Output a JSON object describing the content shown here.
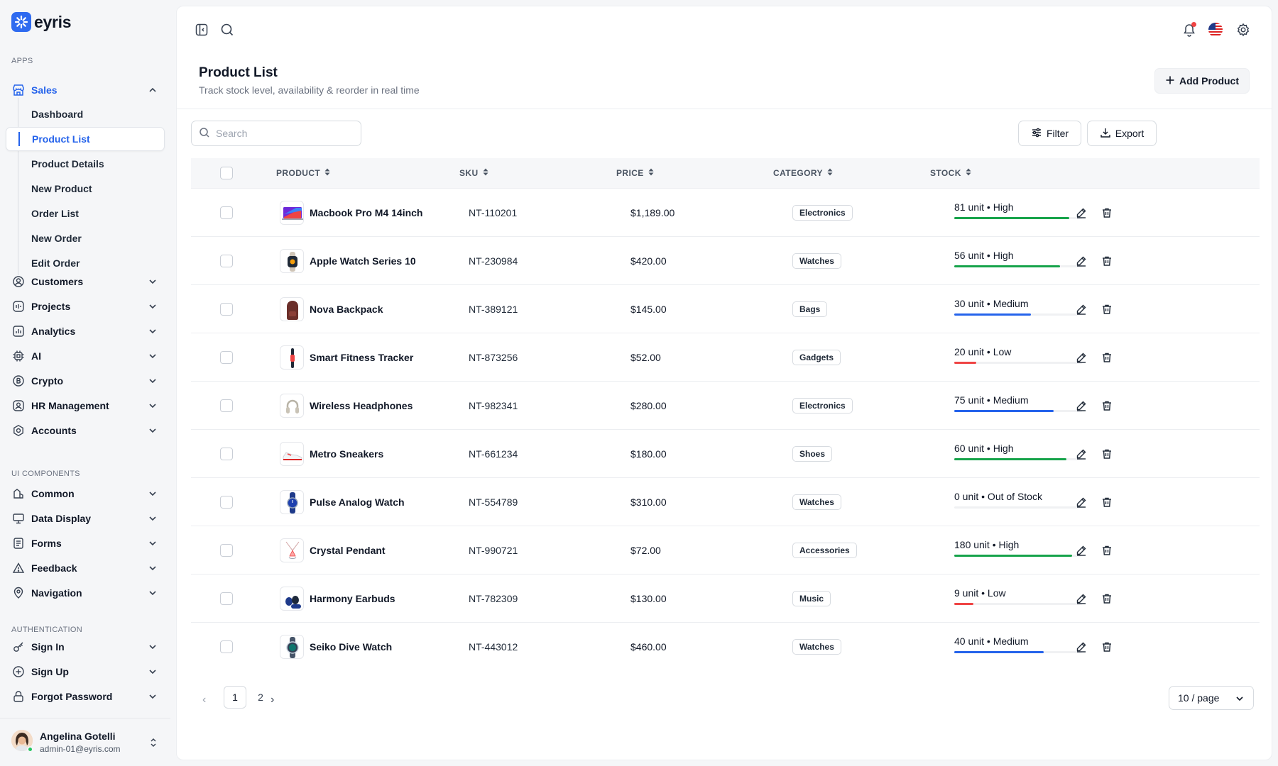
{
  "brand": {
    "name": "eyris",
    "color": "#2f6bf0"
  },
  "sidebar": {
    "sections": {
      "apps": "APPS",
      "ui": "UI COMPONENTS",
      "auth": "AUTHENTICATION"
    },
    "sales": {
      "label": "Sales",
      "icon": "store-icon"
    },
    "sales_sub": [
      "Dashboard",
      "Product List",
      "Product Details",
      "New Product",
      "Order List",
      "New Order",
      "Edit Order"
    ],
    "active_sub": "Product List",
    "groups": [
      {
        "label": "Customers",
        "icon": "user-circle-icon"
      },
      {
        "label": "Projects",
        "icon": "projects-icon"
      },
      {
        "label": "Analytics",
        "icon": "analytics-icon"
      },
      {
        "label": "AI",
        "icon": "chip-icon"
      },
      {
        "label": "Crypto",
        "icon": "bitcoin-icon"
      },
      {
        "label": "HR Management",
        "icon": "hr-icon"
      },
      {
        "label": "Accounts",
        "icon": "accounts-icon"
      }
    ],
    "ui_groups": [
      {
        "label": "Common",
        "icon": "common-icon"
      },
      {
        "label": "Data Display",
        "icon": "monitor-icon"
      },
      {
        "label": "Forms",
        "icon": "forms-icon"
      },
      {
        "label": "Feedback",
        "icon": "warning-icon"
      },
      {
        "label": "Navigation",
        "icon": "location-icon"
      }
    ],
    "auth_groups": [
      {
        "label": "Sign In",
        "icon": "key-icon"
      },
      {
        "label": "Sign Up",
        "icon": "plus-circle-icon"
      },
      {
        "label": "Forgot Password",
        "icon": "lock-icon"
      }
    ],
    "user": {
      "name": "Angelina Gotelli",
      "email": "admin-01@eyris.com",
      "status_color": "#22c55e"
    }
  },
  "header": {
    "title": "Product List",
    "subtitle": "Track stock level, availability & reorder in real time",
    "add_label": "Add Product"
  },
  "toolbar": {
    "search_placeholder": "Search",
    "filter_label": "Filter",
    "export_label": "Export"
  },
  "table": {
    "columns": [
      "PRODUCT",
      "SKU",
      "PRICE",
      "CATEGORY",
      "STOCK"
    ],
    "rows": [
      {
        "name": "Macbook Pro M4 14inch",
        "sku": "NT-110201",
        "price": "$1,189.00",
        "category": "Electronics",
        "stock": "81 unit • High",
        "level": 0.9,
        "color": "#16a34a",
        "thumb": "laptop"
      },
      {
        "name": "Apple Watch Series 10",
        "sku": "NT-230984",
        "price": "$420.00",
        "category": "Watches",
        "stock": "56 unit • High",
        "level": 0.83,
        "color": "#16a34a",
        "thumb": "watch-dark"
      },
      {
        "name": "Nova Backpack",
        "sku": "NT-389121",
        "price": "$145.00",
        "category": "Bags",
        "stock": "30 unit • Medium",
        "level": 0.6,
        "color": "#2563eb",
        "thumb": "backpack"
      },
      {
        "name": "Smart Fitness Tracker",
        "sku": "NT-873256",
        "price": "$52.00",
        "category": "Gadgets",
        "stock": "20 unit • Low",
        "level": 0.17,
        "color": "#ef4444",
        "thumb": "tracker"
      },
      {
        "name": "Wireless Headphones",
        "sku": "NT-982341",
        "price": "$280.00",
        "category": "Electronics",
        "stock": "75 unit • Medium",
        "level": 0.78,
        "color": "#2563eb",
        "thumb": "headphones"
      },
      {
        "name": "Metro Sneakers",
        "sku": "NT-661234",
        "price": "$180.00",
        "category": "Shoes",
        "stock": "60 unit • High",
        "level": 0.88,
        "color": "#16a34a",
        "thumb": "sneaker"
      },
      {
        "name": "Pulse Analog Watch",
        "sku": "NT-554789",
        "price": "$310.00",
        "category": "Watches",
        "stock": "0 unit • Out of Stock",
        "level": 0,
        "color": "#9ca3af",
        "thumb": "watch-blue"
      },
      {
        "name": "Crystal Pendant",
        "sku": "NT-990721",
        "price": "$72.00",
        "category": "Accessories",
        "stock": "180 unit • High",
        "level": 0.92,
        "color": "#16a34a",
        "thumb": "pendant"
      },
      {
        "name": "Harmony Earbuds",
        "sku": "NT-782309",
        "price": "$130.00",
        "category": "Music",
        "stock": "9 unit • Low",
        "level": 0.15,
        "color": "#ef4444",
        "thumb": "earbuds"
      },
      {
        "name": "Seiko Dive Watch",
        "sku": "NT-443012",
        "price": "$460.00",
        "category": "Watches",
        "stock": "40 unit • Medium",
        "level": 0.7,
        "color": "#2563eb",
        "thumb": "watch-teal"
      }
    ]
  },
  "pagination": {
    "pages": [
      "1",
      "2"
    ],
    "current": "1",
    "per_page": "10 / page"
  }
}
